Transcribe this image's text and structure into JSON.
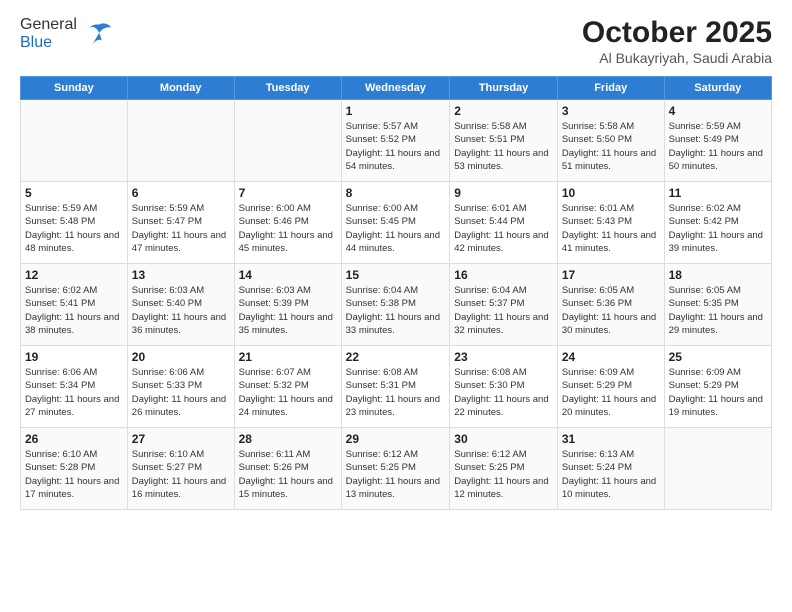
{
  "header": {
    "logo_general": "General",
    "logo_blue": "Blue",
    "month_title": "October 2025",
    "location": "Al Bukayriyah, Saudi Arabia"
  },
  "days_of_week": [
    "Sunday",
    "Monday",
    "Tuesday",
    "Wednesday",
    "Thursday",
    "Friday",
    "Saturday"
  ],
  "weeks": [
    [
      {
        "day": "",
        "sunrise": "",
        "sunset": "",
        "daylight": ""
      },
      {
        "day": "",
        "sunrise": "",
        "sunset": "",
        "daylight": ""
      },
      {
        "day": "",
        "sunrise": "",
        "sunset": "",
        "daylight": ""
      },
      {
        "day": "1",
        "sunrise": "Sunrise: 5:57 AM",
        "sunset": "Sunset: 5:52 PM",
        "daylight": "Daylight: 11 hours and 54 minutes."
      },
      {
        "day": "2",
        "sunrise": "Sunrise: 5:58 AM",
        "sunset": "Sunset: 5:51 PM",
        "daylight": "Daylight: 11 hours and 53 minutes."
      },
      {
        "day": "3",
        "sunrise": "Sunrise: 5:58 AM",
        "sunset": "Sunset: 5:50 PM",
        "daylight": "Daylight: 11 hours and 51 minutes."
      },
      {
        "day": "4",
        "sunrise": "Sunrise: 5:59 AM",
        "sunset": "Sunset: 5:49 PM",
        "daylight": "Daylight: 11 hours and 50 minutes."
      }
    ],
    [
      {
        "day": "5",
        "sunrise": "Sunrise: 5:59 AM",
        "sunset": "Sunset: 5:48 PM",
        "daylight": "Daylight: 11 hours and 48 minutes."
      },
      {
        "day": "6",
        "sunrise": "Sunrise: 5:59 AM",
        "sunset": "Sunset: 5:47 PM",
        "daylight": "Daylight: 11 hours and 47 minutes."
      },
      {
        "day": "7",
        "sunrise": "Sunrise: 6:00 AM",
        "sunset": "Sunset: 5:46 PM",
        "daylight": "Daylight: 11 hours and 45 minutes."
      },
      {
        "day": "8",
        "sunrise": "Sunrise: 6:00 AM",
        "sunset": "Sunset: 5:45 PM",
        "daylight": "Daylight: 11 hours and 44 minutes."
      },
      {
        "day": "9",
        "sunrise": "Sunrise: 6:01 AM",
        "sunset": "Sunset: 5:44 PM",
        "daylight": "Daylight: 11 hours and 42 minutes."
      },
      {
        "day": "10",
        "sunrise": "Sunrise: 6:01 AM",
        "sunset": "Sunset: 5:43 PM",
        "daylight": "Daylight: 11 hours and 41 minutes."
      },
      {
        "day": "11",
        "sunrise": "Sunrise: 6:02 AM",
        "sunset": "Sunset: 5:42 PM",
        "daylight": "Daylight: 11 hours and 39 minutes."
      }
    ],
    [
      {
        "day": "12",
        "sunrise": "Sunrise: 6:02 AM",
        "sunset": "Sunset: 5:41 PM",
        "daylight": "Daylight: 11 hours and 38 minutes."
      },
      {
        "day": "13",
        "sunrise": "Sunrise: 6:03 AM",
        "sunset": "Sunset: 5:40 PM",
        "daylight": "Daylight: 11 hours and 36 minutes."
      },
      {
        "day": "14",
        "sunrise": "Sunrise: 6:03 AM",
        "sunset": "Sunset: 5:39 PM",
        "daylight": "Daylight: 11 hours and 35 minutes."
      },
      {
        "day": "15",
        "sunrise": "Sunrise: 6:04 AM",
        "sunset": "Sunset: 5:38 PM",
        "daylight": "Daylight: 11 hours and 33 minutes."
      },
      {
        "day": "16",
        "sunrise": "Sunrise: 6:04 AM",
        "sunset": "Sunset: 5:37 PM",
        "daylight": "Daylight: 11 hours and 32 minutes."
      },
      {
        "day": "17",
        "sunrise": "Sunrise: 6:05 AM",
        "sunset": "Sunset: 5:36 PM",
        "daylight": "Daylight: 11 hours and 30 minutes."
      },
      {
        "day": "18",
        "sunrise": "Sunrise: 6:05 AM",
        "sunset": "Sunset: 5:35 PM",
        "daylight": "Daylight: 11 hours and 29 minutes."
      }
    ],
    [
      {
        "day": "19",
        "sunrise": "Sunrise: 6:06 AM",
        "sunset": "Sunset: 5:34 PM",
        "daylight": "Daylight: 11 hours and 27 minutes."
      },
      {
        "day": "20",
        "sunrise": "Sunrise: 6:06 AM",
        "sunset": "Sunset: 5:33 PM",
        "daylight": "Daylight: 11 hours and 26 minutes."
      },
      {
        "day": "21",
        "sunrise": "Sunrise: 6:07 AM",
        "sunset": "Sunset: 5:32 PM",
        "daylight": "Daylight: 11 hours and 24 minutes."
      },
      {
        "day": "22",
        "sunrise": "Sunrise: 6:08 AM",
        "sunset": "Sunset: 5:31 PM",
        "daylight": "Daylight: 11 hours and 23 minutes."
      },
      {
        "day": "23",
        "sunrise": "Sunrise: 6:08 AM",
        "sunset": "Sunset: 5:30 PM",
        "daylight": "Daylight: 11 hours and 22 minutes."
      },
      {
        "day": "24",
        "sunrise": "Sunrise: 6:09 AM",
        "sunset": "Sunset: 5:29 PM",
        "daylight": "Daylight: 11 hours and 20 minutes."
      },
      {
        "day": "25",
        "sunrise": "Sunrise: 6:09 AM",
        "sunset": "Sunset: 5:29 PM",
        "daylight": "Daylight: 11 hours and 19 minutes."
      }
    ],
    [
      {
        "day": "26",
        "sunrise": "Sunrise: 6:10 AM",
        "sunset": "Sunset: 5:28 PM",
        "daylight": "Daylight: 11 hours and 17 minutes."
      },
      {
        "day": "27",
        "sunrise": "Sunrise: 6:10 AM",
        "sunset": "Sunset: 5:27 PM",
        "daylight": "Daylight: 11 hours and 16 minutes."
      },
      {
        "day": "28",
        "sunrise": "Sunrise: 6:11 AM",
        "sunset": "Sunset: 5:26 PM",
        "daylight": "Daylight: 11 hours and 15 minutes."
      },
      {
        "day": "29",
        "sunrise": "Sunrise: 6:12 AM",
        "sunset": "Sunset: 5:25 PM",
        "daylight": "Daylight: 11 hours and 13 minutes."
      },
      {
        "day": "30",
        "sunrise": "Sunrise: 6:12 AM",
        "sunset": "Sunset: 5:25 PM",
        "daylight": "Daylight: 11 hours and 12 minutes."
      },
      {
        "day": "31",
        "sunrise": "Sunrise: 6:13 AM",
        "sunset": "Sunset: 5:24 PM",
        "daylight": "Daylight: 11 hours and 10 minutes."
      },
      {
        "day": "",
        "sunrise": "",
        "sunset": "",
        "daylight": ""
      }
    ]
  ]
}
